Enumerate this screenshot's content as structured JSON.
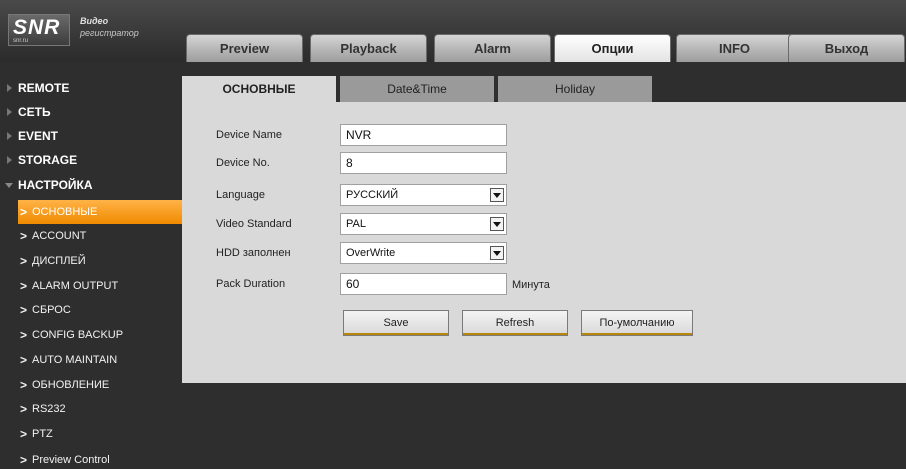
{
  "brand": {
    "logo_text": "SNR",
    "logo_subtext": "snr.ru",
    "tagline_1": "Видео",
    "tagline_2": "регистратор"
  },
  "main_tabs": [
    {
      "label": "Preview"
    },
    {
      "label": "Playback"
    },
    {
      "label": "Alarm"
    },
    {
      "label": "Опции",
      "active": true
    },
    {
      "label": "INFO"
    },
    {
      "label": "Выход"
    }
  ],
  "sidebar": {
    "categories": [
      {
        "label": "REMOTE"
      },
      {
        "label": "СЕТЬ"
      },
      {
        "label": "EVENT"
      },
      {
        "label": "STORAGE"
      },
      {
        "label": "НАСТРОЙКА",
        "expanded": true
      }
    ],
    "items": [
      {
        "label": "ОСНОВНЫЕ",
        "active": true
      },
      {
        "label": "ACCOUNT"
      },
      {
        "label": "ДИСПЛЕЙ"
      },
      {
        "label": "ALARM OUTPUT"
      },
      {
        "label": "СБРОС"
      },
      {
        "label": "CONFIG BACKUP"
      },
      {
        "label": "AUTO MAINTAIN"
      },
      {
        "label": "ОБНОВЛЕНИЕ"
      },
      {
        "label": "RS232"
      },
      {
        "label": "PTZ"
      },
      {
        "label": "Preview Control"
      }
    ]
  },
  "sub_tabs": [
    {
      "label": "ОСНОВНЫЕ",
      "active": true
    },
    {
      "label": "Date&Time"
    },
    {
      "label": "Holiday"
    }
  ],
  "form": {
    "device_name": {
      "label": "Device Name",
      "value": "NVR"
    },
    "device_no": {
      "label": "Device No.",
      "value": "8"
    },
    "language": {
      "label": "Language",
      "value": "РУССКИЙ"
    },
    "video_standard": {
      "label": "Video Standard",
      "value": "PAL"
    },
    "hdd_full": {
      "label": "HDD заполнен",
      "value": "OverWrite"
    },
    "pack_duration": {
      "label": "Pack Duration",
      "value": "60",
      "unit": "Минута"
    }
  },
  "buttons": {
    "save": "Save",
    "refresh": "Refresh",
    "default": "По-умолчанию"
  },
  "colors": {
    "accent": "#f08a00",
    "panel": "#d9d9d9",
    "background": "#2e2e2e"
  }
}
